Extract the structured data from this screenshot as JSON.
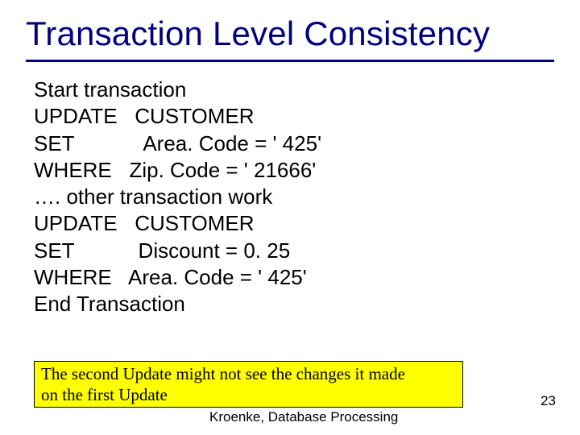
{
  "title": "Transaction Level Consistency",
  "code": {
    "l1": "Start transaction",
    "l2": "UPDATE   CUSTOMER",
    "l3": "SET            Area. Code = ' 425'",
    "l4": "WHERE   Zip. Code = ' 21666'",
    "l5": "…. other transaction work",
    "l6": "UPDATE   CUSTOMER",
    "l7": "SET           Discount = 0. 25",
    "l8": "WHERE   Area. Code = ' 425'",
    "l9": "End Transaction"
  },
  "highlight": {
    "line1": "The second Update might not see the changes it made",
    "line2": "on the first Update"
  },
  "footer": {
    "citation": "Kroenke, Database Processing",
    "page": "23"
  }
}
